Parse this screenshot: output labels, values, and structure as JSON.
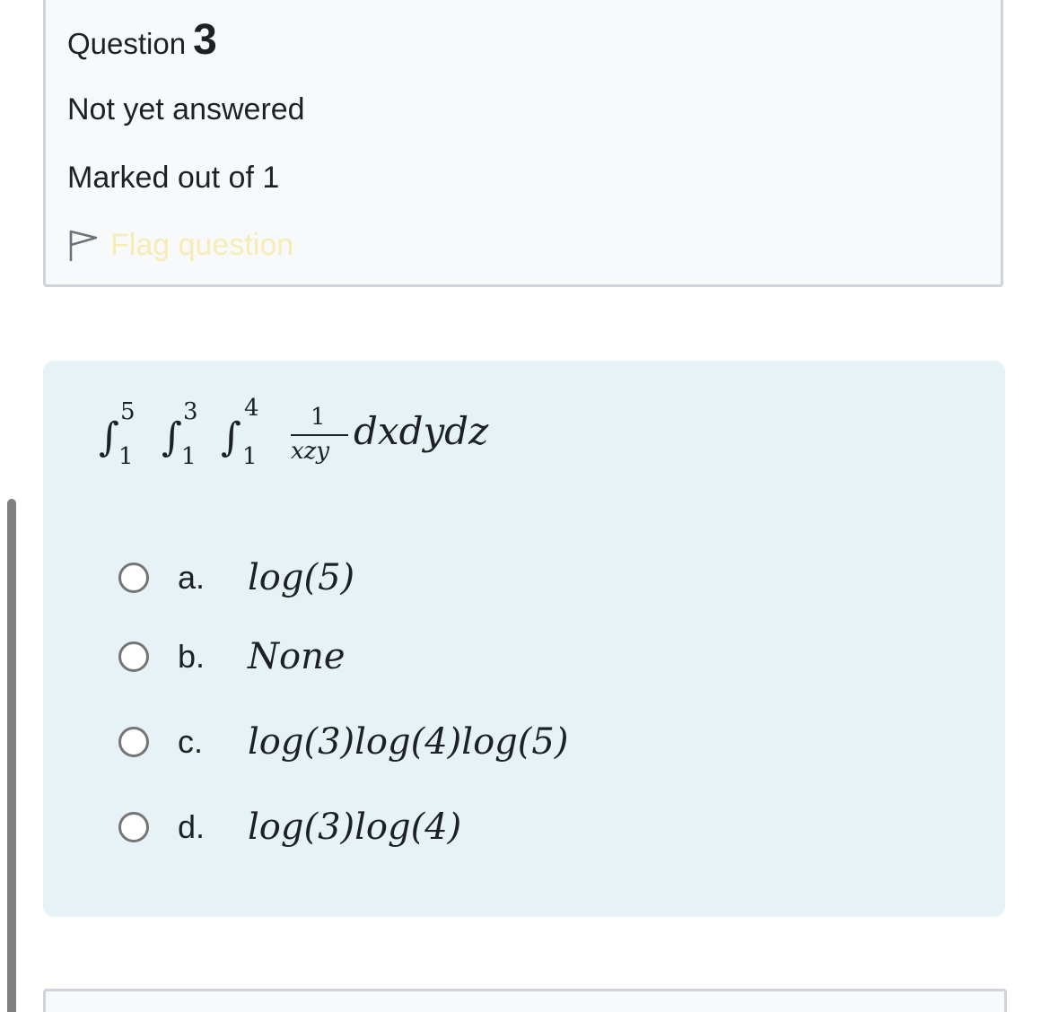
{
  "question": {
    "label": "Question",
    "number": "3",
    "state": "Not yet answered",
    "grade": "Marked out of 1",
    "flag_label": "Flag question",
    "flag_icon": "flag-outline-icon"
  },
  "formula": {
    "integrals": [
      {
        "upper": "5",
        "lower": "1"
      },
      {
        "upper": "3",
        "lower": "1"
      },
      {
        "upper": "4",
        "lower": "1"
      }
    ],
    "numerator": "1",
    "denominator": "xzy",
    "differentials": "dxdydz"
  },
  "options": [
    {
      "letter": "a.",
      "text": "log(5)"
    },
    {
      "letter": "b.",
      "text": "None"
    },
    {
      "letter": "c.",
      "text": "log(3)log(4)log(5)"
    },
    {
      "letter": "d.",
      "text": "log(3)log(4)"
    }
  ],
  "colors": {
    "info_bg": "#f8f9fa",
    "info_border": "#ced4da",
    "content_bg": "#e6f2f5",
    "flag_text": "#f7ecb4",
    "radio_border": "#757575"
  }
}
